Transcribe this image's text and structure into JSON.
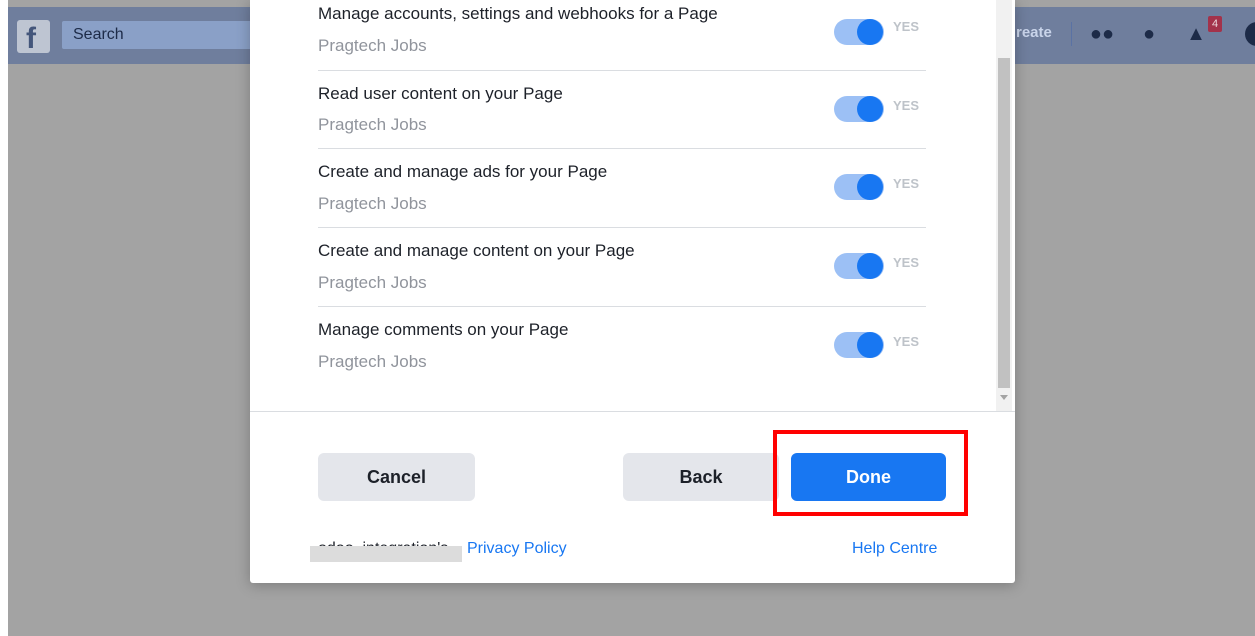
{
  "topbar": {
    "search_placeholder": "Search",
    "create_label": "reate",
    "notification_count": "4",
    "icons": [
      "facebook-logo-icon",
      "friends-icon",
      "messenger-icon",
      "bell-icon",
      "account-icon"
    ],
    "brand_color": "#3b5998"
  },
  "dialog": {
    "permissions": [
      {
        "title": "Manage accounts, settings and webhooks for a Page",
        "page": "Pragtech Jobs",
        "toggle": "YES"
      },
      {
        "title": "Read user content on your Page",
        "page": "Pragtech Jobs",
        "toggle": "YES"
      },
      {
        "title": "Create and manage ads for your Page",
        "page": "Pragtech Jobs",
        "toggle": "YES"
      },
      {
        "title": "Create and manage content on your Page",
        "page": "Pragtech Jobs",
        "toggle": "YES"
      },
      {
        "title": "Manage comments on your Page",
        "page": "Pragtech Jobs",
        "toggle": "YES"
      }
    ],
    "buttons": {
      "cancel": "Cancel",
      "back": "Back",
      "done": "Done"
    },
    "footer": {
      "app_name": "odoo_integration's",
      "privacy_link": "Privacy Policy",
      "help_link": "Help Centre"
    },
    "accent_color": "#1877f2",
    "highlight_color": "#ff0000"
  }
}
